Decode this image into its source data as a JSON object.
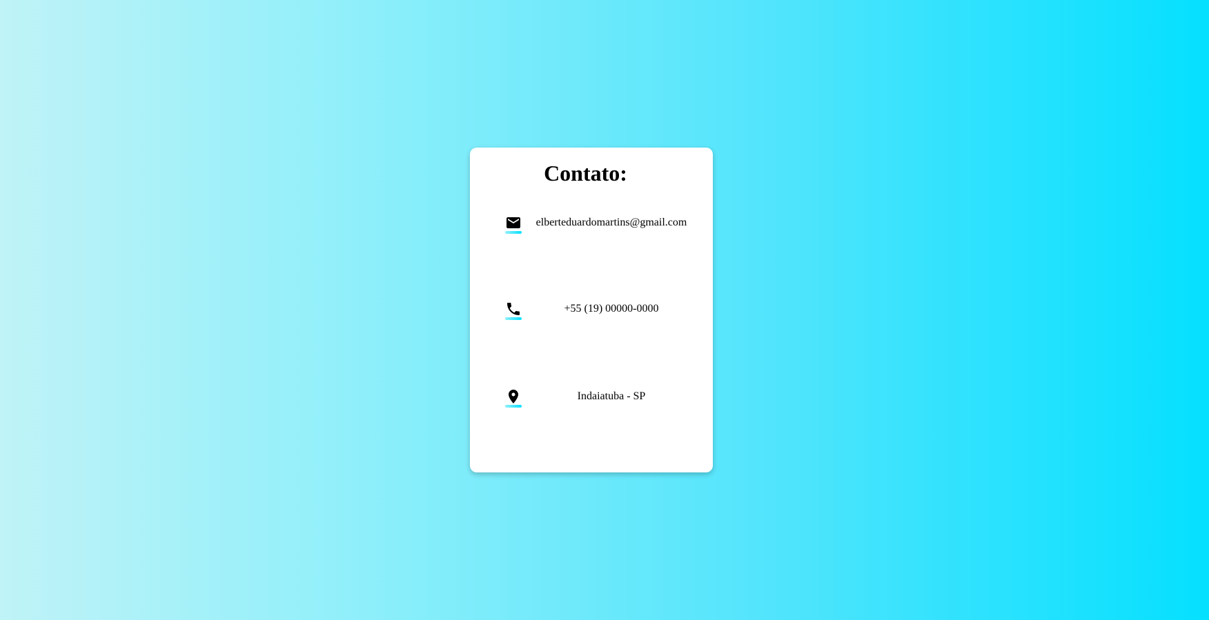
{
  "card": {
    "title": "Contato:"
  },
  "contacts": [
    {
      "icon": "email-icon",
      "text": "elberteduardomartins@gmail.com"
    },
    {
      "icon": "phone-icon",
      "text": "+55 (19) 00000-0000"
    },
    {
      "icon": "location-pin-icon",
      "text": "Indaiatuba - SP"
    }
  ],
  "colors": {
    "gradient_start": "#bff3f7",
    "gradient_end": "#05e0ff",
    "card_background": "#ffffff",
    "accent": "#05e0ff"
  }
}
